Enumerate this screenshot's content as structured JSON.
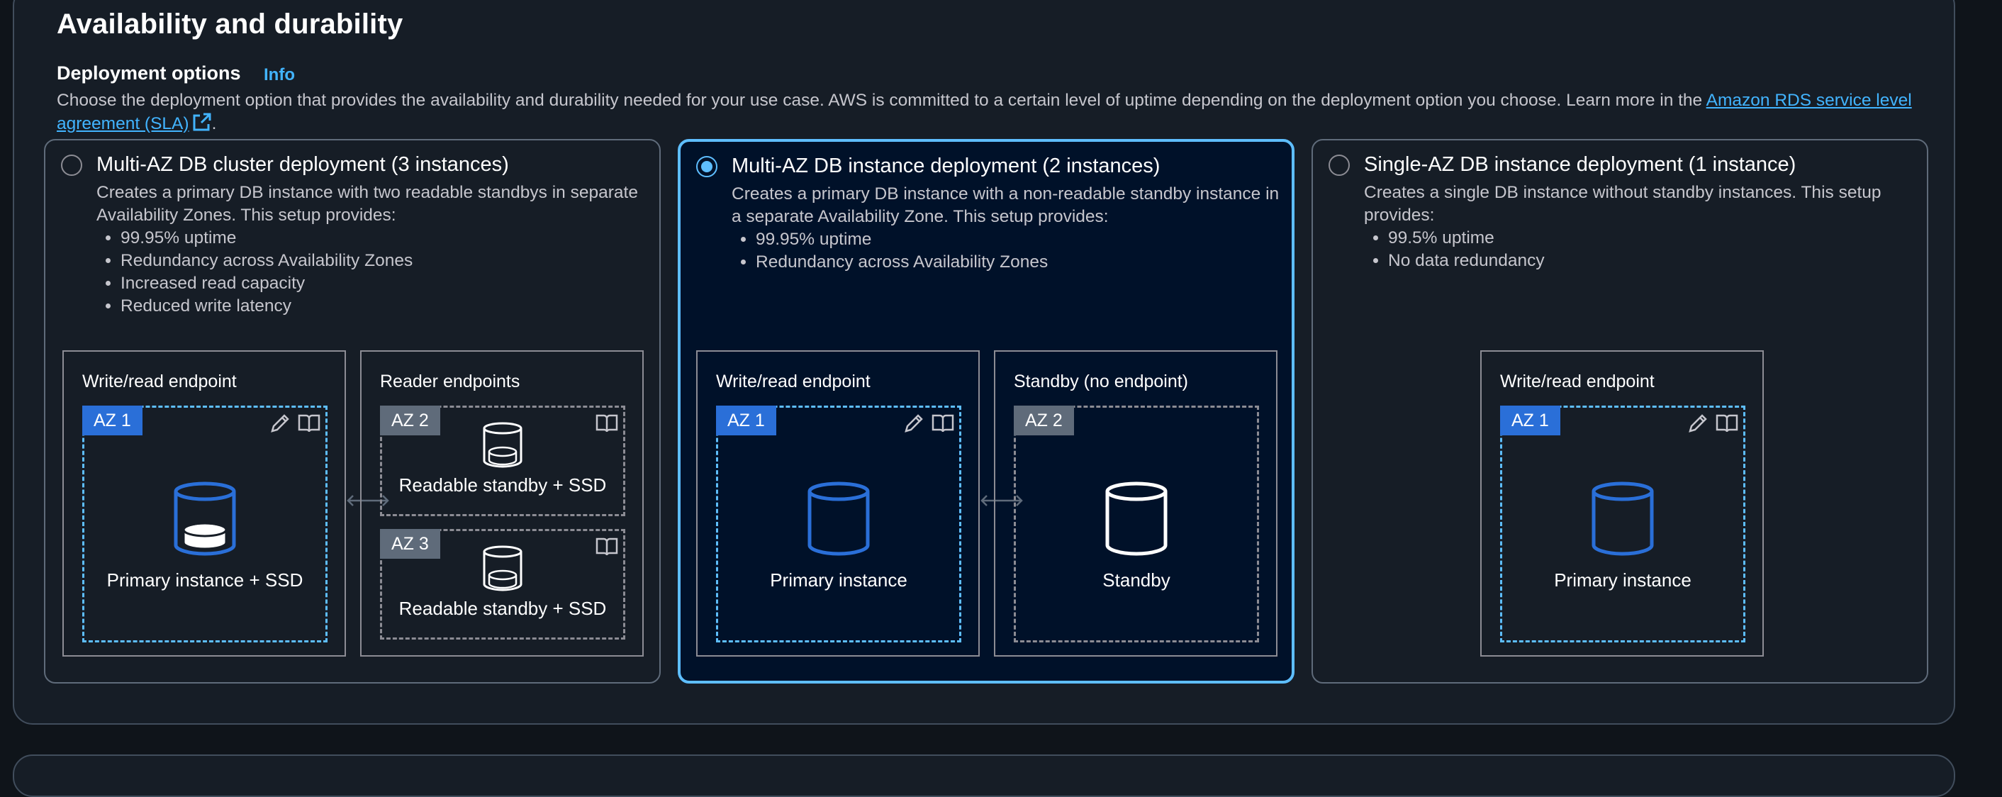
{
  "section": {
    "title": "Availability and durability",
    "deployment_label": "Deployment options",
    "info_label": "Info",
    "description_text": "Choose the deployment option that provides the availability and durability needed for your use case. AWS is committed to a certain level of uptime depending on the deployment option you choose. Learn more in the ",
    "description_link": "Amazon RDS service level agreement (SLA)",
    "description_end": "."
  },
  "options": [
    {
      "title": "Multi-AZ DB cluster deployment (3 instances)",
      "selected": false,
      "description": "Creates a primary DB instance with two readable standbys in separate Availability Zones. This setup provides:",
      "bullets": [
        "99.95% uptime",
        "Redundancy across Availability Zones",
        "Increased read capacity",
        "Reduced write latency"
      ],
      "panels": [
        {
          "label": "Write/read endpoint",
          "az": "AZ 1",
          "instance_label": "Primary instance + SSD"
        },
        {
          "label": "Reader endpoints",
          "zones": [
            {
              "az": "AZ 2",
              "instance_label": "Readable standby + SSD"
            },
            {
              "az": "AZ 3",
              "instance_label": "Readable standby + SSD"
            }
          ]
        }
      ]
    },
    {
      "title": "Multi-AZ DB instance deployment (2 instances)",
      "selected": true,
      "description": "Creates a primary DB instance with a non-readable standby instance in a separate Availability Zone. This setup provides:",
      "bullets": [
        "99.95% uptime",
        "Redundancy across Availability Zones"
      ],
      "panels": [
        {
          "label": "Write/read endpoint",
          "az": "AZ 1",
          "instance_label": "Primary instance"
        },
        {
          "label": "Standby (no endpoint)",
          "az": "AZ 2",
          "instance_label": "Standby"
        }
      ]
    },
    {
      "title": "Single-AZ DB instance deployment (1 instance)",
      "selected": false,
      "description": "Creates a single DB instance without standby instances. This setup provides:",
      "bullets": [
        "99.5% uptime",
        "No data redundancy"
      ],
      "panels": [
        {
          "label": "Write/read endpoint",
          "az": "AZ 1",
          "instance_label": "Primary instance"
        }
      ]
    }
  ],
  "colors": {
    "accent": "#5ebeff",
    "az_tag": "#2a6fd8",
    "az_tag_grey": "#5f6b7a",
    "selected_bg": "#001129",
    "background": "#161d26"
  },
  "icons": [
    "pencil-icon",
    "book-icon",
    "external-link-icon",
    "database-icon",
    "bidirectional-arrow-icon"
  ]
}
